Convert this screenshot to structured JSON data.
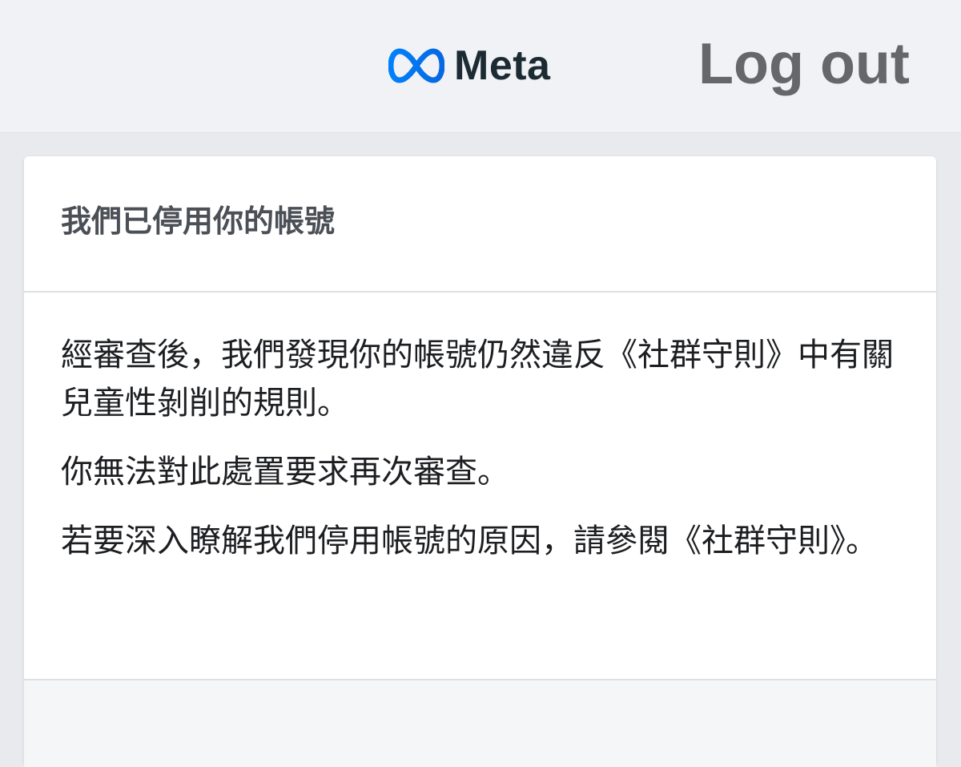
{
  "header": {
    "brand": "Meta",
    "logout_label": "Log out"
  },
  "notice": {
    "title": "我們已停用你的帳號",
    "paragraphs": [
      "經審查後，我們發現你的帳號仍然違反《社群守則》中有關兒童性剝削的規則。",
      "你無法對此處置要求再次審查。",
      "若要深入瞭解我們停用帳號的原因，請參閱《社群守則》。"
    ]
  },
  "colors": {
    "brand_blue": "#0668E1",
    "wordmark": "#1c2b33",
    "logout_text": "#65676b",
    "background": "#e9eaed"
  },
  "icons": {
    "logo": "meta-infinity-icon"
  }
}
